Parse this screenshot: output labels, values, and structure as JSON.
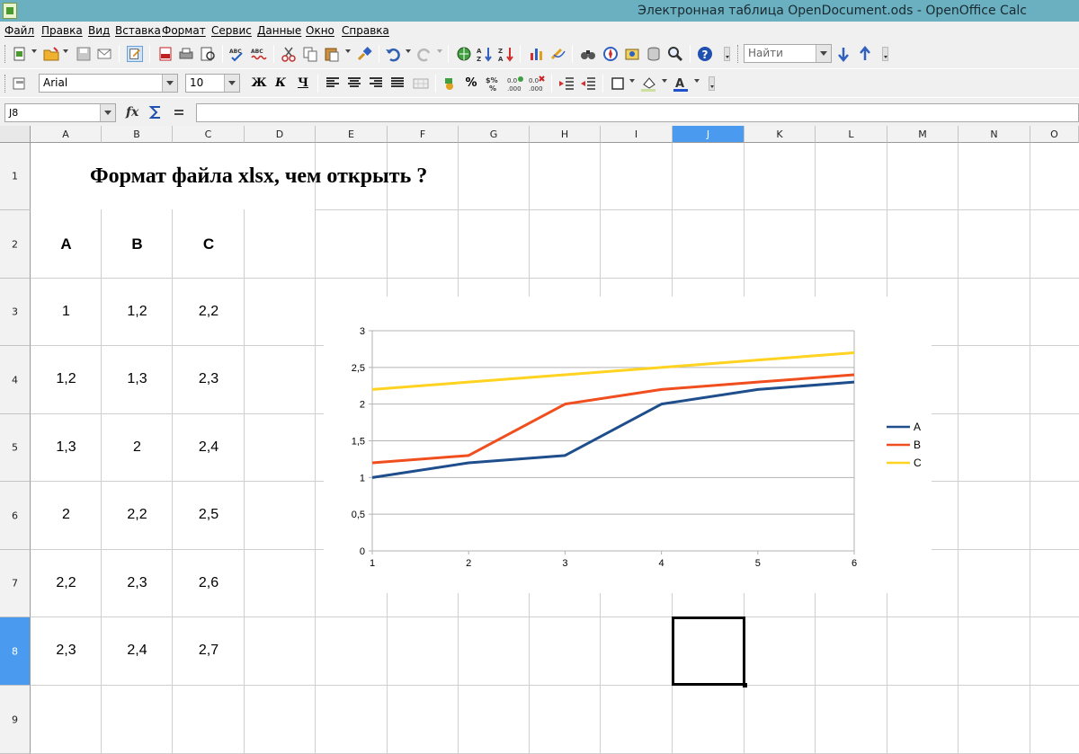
{
  "window": {
    "title": "Электронная таблица OpenDocument.ods - OpenOffice Calc"
  },
  "menu": [
    "Файл",
    "Правка",
    "Вид",
    "Вставка",
    "Формат",
    "Сервис",
    "Данные",
    "Окно",
    "Справка"
  ],
  "toolbar": {
    "font_name": "Arial",
    "font_size": "10",
    "search_placeholder": "Найти",
    "bold_label": "Ж",
    "italic_label": "К",
    "underline_label": "Ч",
    "percent_label": "%"
  },
  "formula_bar": {
    "cell_ref": "J8",
    "content": ""
  },
  "columns": [
    "A",
    "B",
    "C",
    "D",
    "E",
    "F",
    "G",
    "H",
    "I",
    "J",
    "K",
    "L",
    "M",
    "N",
    "O"
  ],
  "rows": [
    "1",
    "2",
    "3",
    "4",
    "5",
    "6",
    "7",
    "8",
    "9"
  ],
  "selected_cell": {
    "col": "J",
    "row": "8"
  },
  "sheet": {
    "title": "Формат файла xlsx, чем открыть ?",
    "headers": [
      "A",
      "B",
      "C"
    ],
    "data": [
      [
        "1",
        "1,2",
        "2,2"
      ],
      [
        "1,2",
        "1,3",
        "2,3"
      ],
      [
        "1,3",
        "2",
        "2,4"
      ],
      [
        "2",
        "2,2",
        "2,5"
      ],
      [
        "2,2",
        "2,3",
        "2,6"
      ],
      [
        "2,3",
        "2,4",
        "2,7"
      ]
    ]
  },
  "chart_data": {
    "type": "line",
    "x": [
      1,
      2,
      3,
      4,
      5,
      6
    ],
    "series": [
      {
        "name": "A",
        "values": [
          1,
          1.2,
          1.3,
          2,
          2.2,
          2.3
        ],
        "color": "#1f4e8c"
      },
      {
        "name": "B",
        "values": [
          1.2,
          1.3,
          2,
          2.2,
          2.3,
          2.4
        ],
        "color": "#f04e1e"
      },
      {
        "name": "C",
        "values": [
          2.2,
          2.3,
          2.4,
          2.5,
          2.6,
          2.7
        ],
        "color": "#ffd320"
      }
    ],
    "y_ticks": [
      "0",
      "0,5",
      "1",
      "1,5",
      "2",
      "2,5",
      "3"
    ],
    "x_ticks": [
      "1",
      "2",
      "3",
      "4",
      "5",
      "6"
    ],
    "ylim": [
      0,
      3
    ],
    "xlim": [
      1,
      6
    ],
    "grid": true,
    "legend": "right"
  }
}
